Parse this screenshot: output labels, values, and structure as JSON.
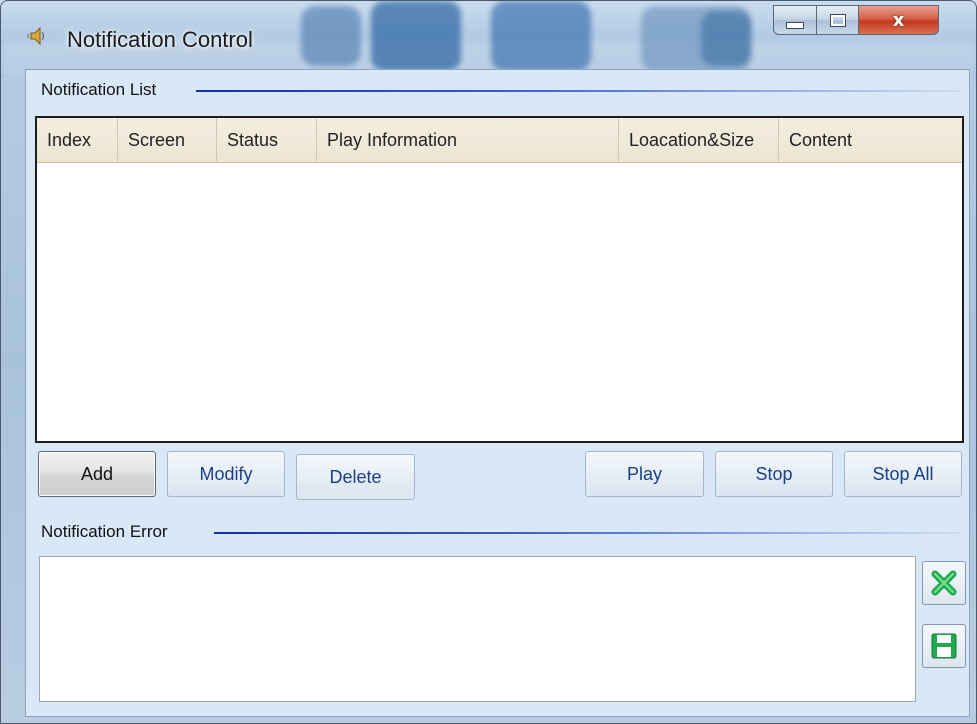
{
  "window": {
    "title": "Notification Control",
    "icon": "speaker-icon",
    "controls": {
      "minimize": "minimize-icon",
      "maximize": "maximize-icon",
      "close_glyph": "x"
    }
  },
  "notification_list": {
    "group_label": "Notification List",
    "columns": [
      "Index",
      "Screen",
      "Status",
      "Play Information",
      "Loacation&Size",
      "Content"
    ],
    "rows": []
  },
  "actions": {
    "add": "Add",
    "modify": "Modify",
    "delete": "Delete",
    "play": "Play",
    "stop": "Stop",
    "stop_all": "Stop All"
  },
  "notification_error": {
    "group_label": "Notification Error",
    "text": "",
    "clear_icon": "clear-x-icon",
    "save_icon": "save-disk-icon"
  },
  "colors": {
    "accent_line": "#1a2db0",
    "button_text": "#1c3f86",
    "clear_icon": "#1fa84a",
    "save_icon": "#22a94f"
  }
}
